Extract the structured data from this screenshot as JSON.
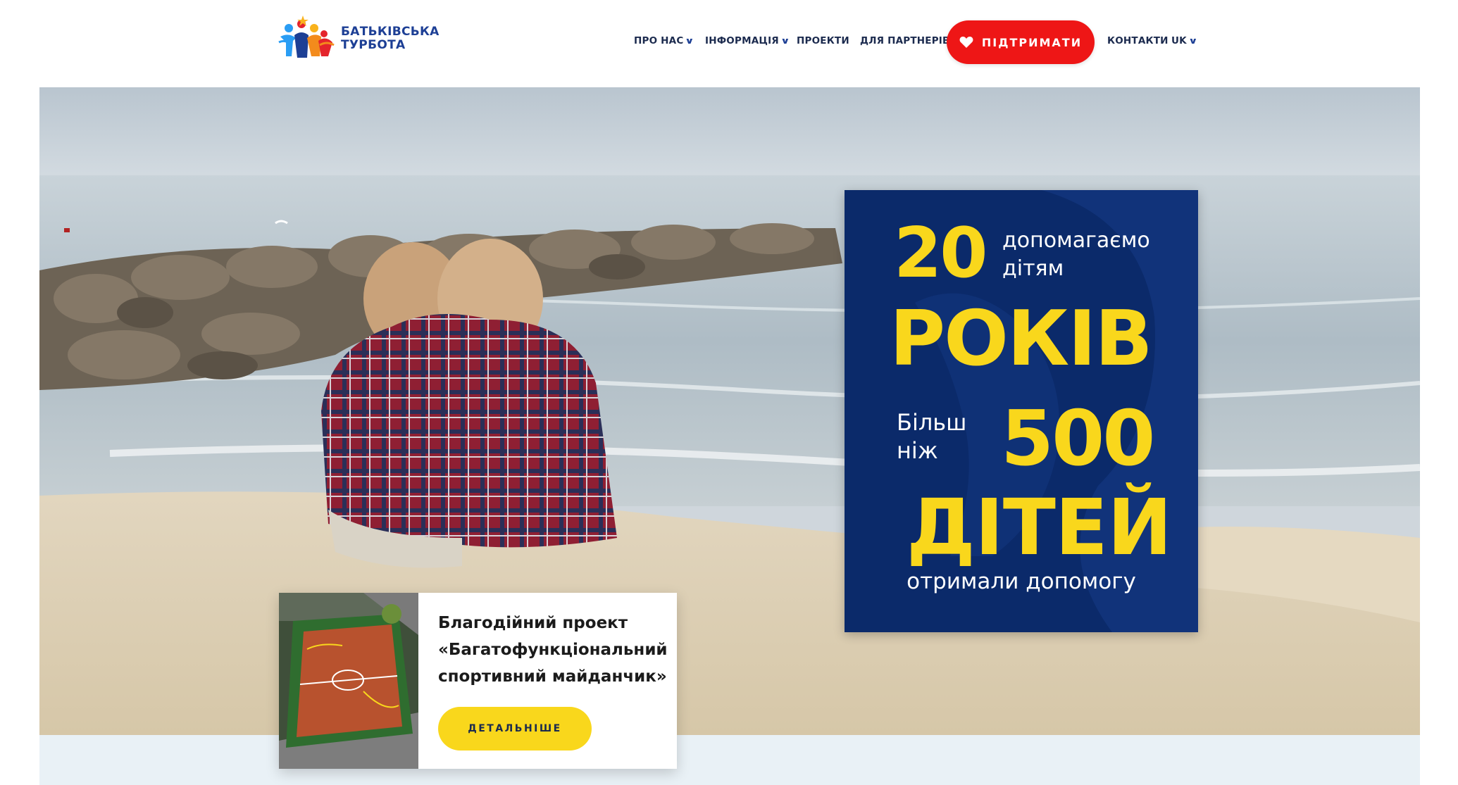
{
  "brand": {
    "line1": "БАТЬКІВСЬКА",
    "line2": "ТУРБОТА"
  },
  "nav": {
    "about": "ПРО НАС",
    "info": "ІНФОРМАЦІЯ",
    "projects": "ПРОЕКТИ",
    "partners": "ДЛЯ ПАРТНЕРІВ",
    "support": "ПІДТРИМАТИ",
    "contacts": "КОНТАКТИ",
    "language": "UK"
  },
  "stats": {
    "years_number": "20",
    "years_caption_line1": "допомагаємо",
    "years_caption_line2": "дітям",
    "years_word": "РОКІВ",
    "more_line1": "Більш",
    "more_line2": "ніж",
    "children_number": "500",
    "children_word": "ДІТЕЙ",
    "received": "отримали допомогу"
  },
  "project": {
    "title_line1": "Благодійний проект",
    "title_line2": "«Багатофункціональний",
    "title_line3": "спортивний майданчик»",
    "button": "ДЕТАЛЬНІШЕ"
  },
  "colors": {
    "brand_blue": "#1d3f95",
    "panel_blue": "#0b2a6a",
    "accent_yellow": "#f9d71c",
    "support_red": "#ee1616"
  },
  "icons": {
    "logo": "family-figures-logo",
    "support": "heart-icon",
    "dropdown": "chevron-down-icon"
  }
}
